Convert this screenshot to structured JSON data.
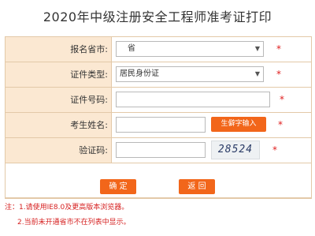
{
  "page": {
    "title": "2020年中级注册安全工程师准考证打印"
  },
  "form": {
    "province": {
      "label": "报名省市:",
      "value": "省",
      "arrow": "▼"
    },
    "id_type": {
      "label": "证件类型:",
      "value": "居民身份证",
      "arrow": "▼"
    },
    "id_number": {
      "label": "证件号码:",
      "value": ""
    },
    "name": {
      "label": "考生姓名:",
      "value": "",
      "rare_char_button": "生僻字输入"
    },
    "captcha": {
      "label": "验证码:",
      "value": "",
      "image_text": "28524"
    },
    "required_mark": "*"
  },
  "actions": {
    "confirm": "确  定",
    "back": "返  回"
  },
  "notes": {
    "line1": "注：1.请使用IE8.0及更高版本浏览器。",
    "line2": "2.当前未开通省市不在列表中显示。"
  },
  "colors": {
    "label_bg": "#fbe8d2",
    "border": "#e3c9a8",
    "button": "#f2661a",
    "required": "#e02020"
  }
}
